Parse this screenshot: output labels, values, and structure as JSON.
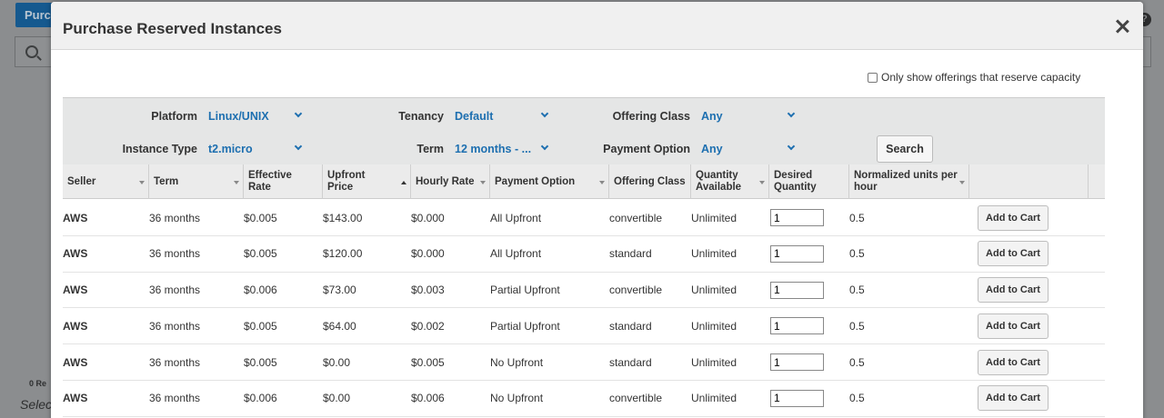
{
  "background": {
    "button_label": "Purc",
    "count_label": "0 Re",
    "select_label": "Selec"
  },
  "modal": {
    "title": "Purchase Reserved Instances",
    "reserve_capacity_label": "Only show offerings that reserve capacity",
    "filters": {
      "platform": {
        "label": "Platform",
        "value": "Linux/UNIX"
      },
      "tenancy": {
        "label": "Tenancy",
        "value": "Default"
      },
      "offering_class": {
        "label": "Offering Class",
        "value": "Any"
      },
      "instance_type": {
        "label": "Instance Type",
        "value": "t2.micro"
      },
      "term": {
        "label": "Term",
        "value": "12 months - ..."
      },
      "payment_option": {
        "label": "Payment Option",
        "value": "Any"
      },
      "search_label": "Search"
    },
    "columns": [
      "Seller",
      "Term",
      "Effective Rate",
      "Upfront Price",
      "Hourly Rate",
      "Payment Option",
      "Offering Class",
      "Quantity Available",
      "Desired Quantity",
      "Normalized units per hour"
    ],
    "rows": [
      {
        "seller": "AWS",
        "term": "36 months",
        "effective_rate": "$0.005",
        "upfront": "$143.00",
        "hourly": "$0.000",
        "payment": "All Upfront",
        "class": "convertible",
        "available": "Unlimited",
        "qty": "1",
        "units": "0.5",
        "action": "Add to Cart"
      },
      {
        "seller": "AWS",
        "term": "36 months",
        "effective_rate": "$0.005",
        "upfront": "$120.00",
        "hourly": "$0.000",
        "payment": "All Upfront",
        "class": "standard",
        "available": "Unlimited",
        "qty": "1",
        "units": "0.5",
        "action": "Add to Cart"
      },
      {
        "seller": "AWS",
        "term": "36 months",
        "effective_rate": "$0.006",
        "upfront": "$73.00",
        "hourly": "$0.003",
        "payment": "Partial Upfront",
        "class": "convertible",
        "available": "Unlimited",
        "qty": "1",
        "units": "0.5",
        "action": "Add to Cart"
      },
      {
        "seller": "AWS",
        "term": "36 months",
        "effective_rate": "$0.005",
        "upfront": "$64.00",
        "hourly": "$0.002",
        "payment": "Partial Upfront",
        "class": "standard",
        "available": "Unlimited",
        "qty": "1",
        "units": "0.5",
        "action": "Add to Cart"
      },
      {
        "seller": "AWS",
        "term": "36 months",
        "effective_rate": "$0.005",
        "upfront": "$0.00",
        "hourly": "$0.005",
        "payment": "No Upfront",
        "class": "standard",
        "available": "Unlimited",
        "qty": "1",
        "units": "0.5",
        "action": "Add to Cart"
      },
      {
        "seller": "AWS",
        "term": "36 months",
        "effective_rate": "$0.006",
        "upfront": "$0.00",
        "hourly": "$0.006",
        "payment": "No Upfront",
        "class": "convertible",
        "available": "Unlimited",
        "qty": "1",
        "units": "0.5",
        "action": "Add to Cart"
      }
    ]
  },
  "colors": {
    "accent": "#1d6fb0",
    "primary_button": "#15598f"
  },
  "icons": [
    "search-icon",
    "help-icon",
    "close-icon",
    "chevron-down-icon",
    "sort-icon",
    "last-page-icon"
  ]
}
